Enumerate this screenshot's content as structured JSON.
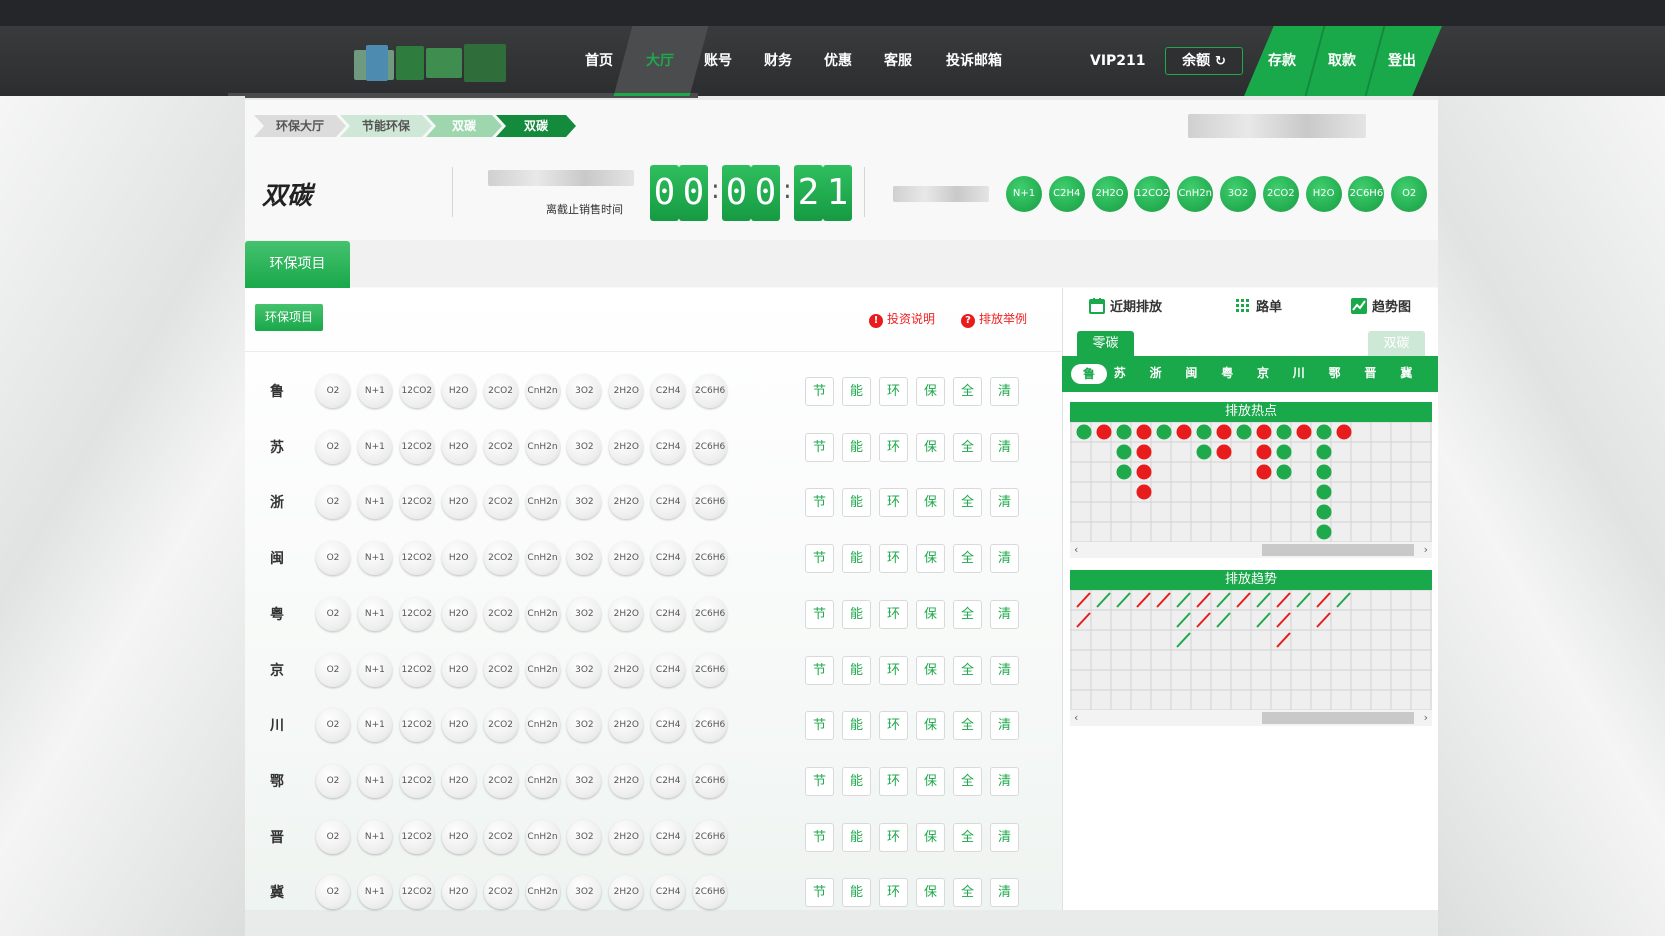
{
  "nav": {
    "items": [
      "首页",
      "大厅",
      "账号",
      "财务",
      "优惠",
      "客服",
      "投诉邮箱"
    ],
    "vip": "VIP211",
    "balance_label": "余额",
    "actions": [
      "存款",
      "取款",
      "登出"
    ]
  },
  "breadcrumb": [
    "环保大厅",
    "节能环保",
    "双碳",
    "双碳"
  ],
  "game": {
    "title": "双碳",
    "countdown_label": "离截止销售时间",
    "countdown_digits": [
      "0",
      "0",
      "0",
      "0",
      "2",
      "1"
    ],
    "header_balls": [
      "N+1",
      "C2H4",
      "2H2O",
      "12CO2",
      "CnH2n",
      "3O2",
      "2CO2",
      "H2O",
      "2C6H6",
      "O2"
    ]
  },
  "tabs": {
    "active": "环保项目"
  },
  "left": {
    "sub_button": "环保项目",
    "links": [
      "投资说明",
      "排放举例"
    ],
    "rows": [
      "鲁",
      "苏",
      "浙",
      "闽",
      "粤",
      "京",
      "川",
      "鄂",
      "晋",
      "冀"
    ],
    "row_balls": [
      "O2",
      "N+1",
      "12CO2",
      "H2O",
      "2CO2",
      "CnH2n",
      "3O2",
      "2H2O",
      "C2H4",
      "2C6H6"
    ],
    "filters": [
      "节",
      "能",
      "环",
      "保",
      "全",
      "清"
    ]
  },
  "right": {
    "tabs": [
      "近期排放",
      "路单",
      "趋势图"
    ],
    "segments": [
      "零碳",
      "双碳"
    ],
    "provinces": [
      "鲁",
      "苏",
      "浙",
      "闽",
      "粤",
      "京",
      "川",
      "鄂",
      "晋",
      "冀"
    ],
    "heat_title": "排放热点",
    "trend_title": "排放趋势",
    "heat_columns": [
      [
        "g"
      ],
      [
        "r"
      ],
      [
        "g",
        "g",
        "g"
      ],
      [
        "r",
        "r",
        "r",
        "r"
      ],
      [
        "g"
      ],
      [
        "r"
      ],
      [
        "g",
        "g"
      ],
      [
        "r",
        "r"
      ],
      [
        "g"
      ],
      [
        "r",
        "r",
        "r"
      ],
      [
        "g",
        "g",
        "g"
      ],
      [
        "r"
      ],
      [
        "g",
        "g",
        "g",
        "g",
        "g",
        "g"
      ],
      [
        "r"
      ]
    ],
    "trend_columns": [
      [
        "r",
        "r"
      ],
      [
        "g"
      ],
      [
        "g"
      ],
      [
        "r"
      ],
      [
        "r"
      ],
      [
        "g",
        "g",
        "g"
      ],
      [
        "r",
        "r"
      ],
      [
        "g",
        "g"
      ],
      [
        "r"
      ],
      [
        "g",
        "g"
      ],
      [
        "r",
        "r",
        "r"
      ],
      [
        "g"
      ],
      [
        "r",
        "r"
      ],
      [
        "g"
      ]
    ],
    "colors": {
      "green": "#1ea94b",
      "red": "#e81c1c"
    }
  }
}
